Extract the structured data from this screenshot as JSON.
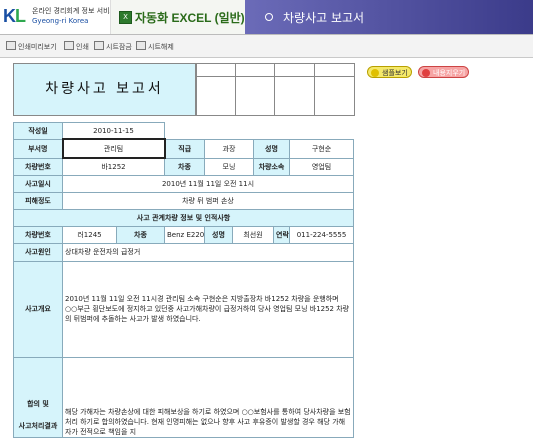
{
  "header": {
    "logo_text": "KL",
    "logo_line1": "온라인 경리회계 정보 서비스",
    "logo_line2": "Gyeong-ri Korea",
    "product_icon": "excel-icon",
    "product_label": "자동화 EXCEL (일반)",
    "page_title": "차량사고 보고서"
  },
  "toolbar": {
    "items": [
      "인쇄미리보기",
      "인쇄",
      "시트잠금",
      "시트해제"
    ]
  },
  "report": {
    "title": "차량사고 보고서"
  },
  "buttons": {
    "sample": "샘플보기",
    "clear": "내용지우기"
  },
  "form": {
    "date_label": "작성일",
    "date_value": "2010-11-15",
    "dept_label": "부서명",
    "dept_value": "관리팀",
    "rank_label": "직급",
    "rank_value": "과장",
    "name_label": "성명",
    "name_value": "구현순",
    "car_no_label": "차량번호",
    "car_no_value": "바1252",
    "car_type_label": "차종",
    "car_type_value": "모닝",
    "car_owner_label": "차량소속",
    "car_owner_value": "영업팀",
    "accident_time_label": "사고일시",
    "accident_time_value": "2010년 11월 11일 오전 11시",
    "damage_label": "피해정도",
    "damage_value": "차량 뒤 범퍼 손상",
    "section_title": "사고 관계차량 정보 및 인적사항",
    "r_car_no_label": "차량번호",
    "r_car_no_value": "러1245",
    "r_car_type_label": "차종",
    "r_car_type_value": "Benz E220",
    "r_name_label": "성명",
    "r_name_value": "최선원",
    "r_contact_label": "연락처",
    "r_contact_value": "011-224-5555",
    "cause_label": "사고원인",
    "cause_value": "상대차량 운전자의 급정거",
    "summary_label": "사고개요",
    "summary_value": "2010년 11월 11일 오전 11시경 관리팀 소속 구현순은 지방출장차 바1252 차량을 운행하며 ○○부근 횡단보도에 정지하고 있던중 사고가해차량이 급정거하여 당사 영업팀 모닝 바1252 차량의 뒤범퍼에 추돌하는 사고가 발생 하였습니다.",
    "agreement_label": "합의 및",
    "agreement_label2": "사고처리결과",
    "agreement_value": "해당 가해자는 차량손상에 대한 피해보상을 하기로 하였으며 ○○보험사를 통하여 당사차량을 보험처리 하기로 합의하였습니다. 현재 인명피해는 없으나 향후 사고 후유증이 발생할 경우 해당 가해자가 전적으로 책임을 지"
  }
}
